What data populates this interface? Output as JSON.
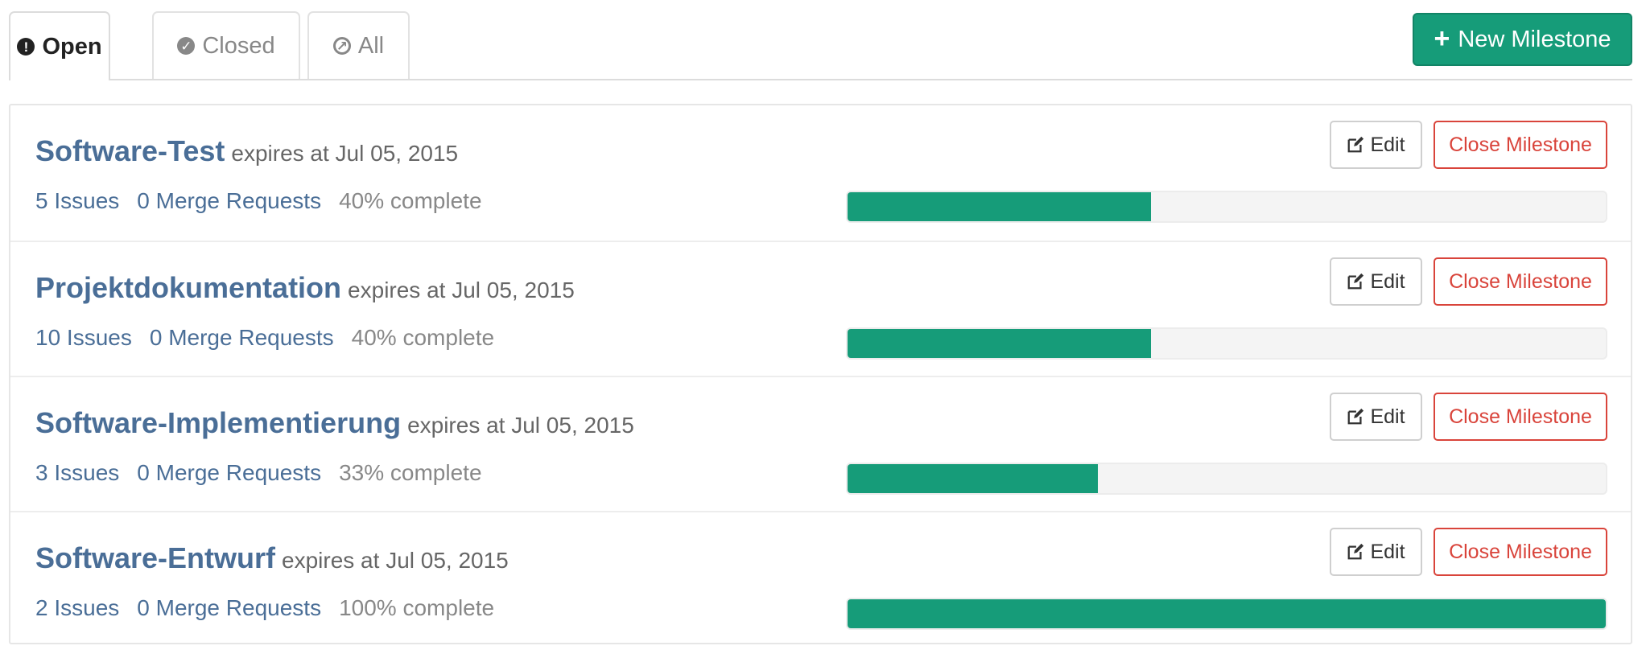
{
  "tabs": [
    {
      "label": "Open",
      "icon": "exclamation-circle-icon",
      "active": true
    },
    {
      "label": "Closed",
      "icon": "check-circle-icon",
      "active": false
    },
    {
      "label": "All",
      "icon": "compass-icon",
      "active": false
    }
  ],
  "new_milestone_label": "New Milestone",
  "accent_color": "#169c79",
  "danger_color": "#d9443b",
  "link_color": "#4a6e97",
  "milestones": [
    {
      "title": "Software-Test",
      "expires": "expires at Jul 05, 2015",
      "issues": "5 Issues",
      "merge_requests": "0 Merge Requests",
      "complete": "40% complete",
      "progress": 40,
      "edit_label": "Edit",
      "close_label": "Close Milestone"
    },
    {
      "title": "Projektdokumentation",
      "expires": "expires at Jul 05, 2015",
      "issues": "10 Issues",
      "merge_requests": "0 Merge Requests",
      "complete": "40% complete",
      "progress": 40,
      "edit_label": "Edit",
      "close_label": "Close Milestone"
    },
    {
      "title": "Software-Implementierung",
      "expires": "expires at Jul 05, 2015",
      "issues": "3 Issues",
      "merge_requests": "0 Merge Requests",
      "complete": "33% complete",
      "progress": 33,
      "edit_label": "Edit",
      "close_label": "Close Milestone"
    },
    {
      "title": "Software-Entwurf",
      "expires": "expires at Jul 05, 2015",
      "issues": "2 Issues",
      "merge_requests": "0 Merge Requests",
      "complete": "100% complete",
      "progress": 100,
      "edit_label": "Edit",
      "close_label": "Close Milestone"
    }
  ]
}
